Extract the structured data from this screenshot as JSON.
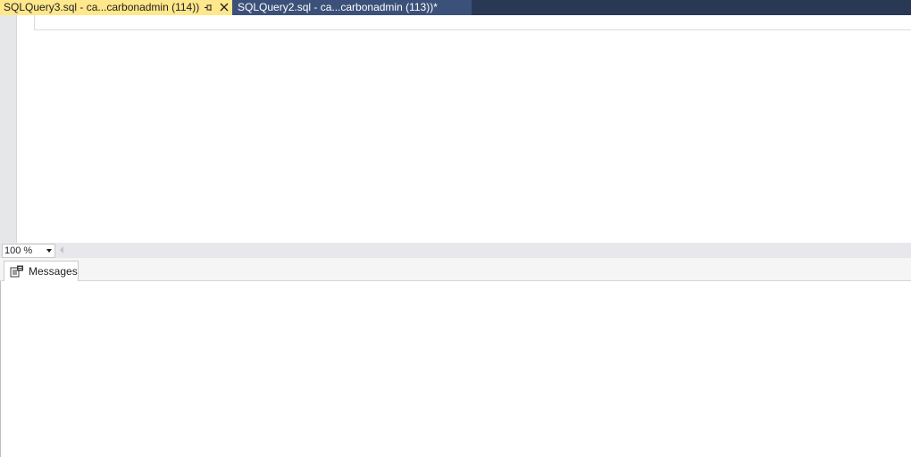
{
  "tabs": {
    "active": {
      "label": "SQLQuery3.sql - ca...carbonadmin (114))"
    },
    "inactive": {
      "label": "SQLQuery2.sql - ca...carbonadmin (113))*"
    }
  },
  "zoom": {
    "value": "100 %"
  },
  "results": {
    "messages_tab_label": "Messages"
  },
  "colors": {
    "tabstrip_background": "#293955",
    "active_tab": "#ffe78c",
    "inactive_tab": "#3c5179"
  },
  "icons": {
    "pin": "pin-icon",
    "close": "close-icon",
    "messages": "messages-icon",
    "dropdown": "chevron-down-icon",
    "scroll_left": "scroll-left-arrow-icon"
  }
}
